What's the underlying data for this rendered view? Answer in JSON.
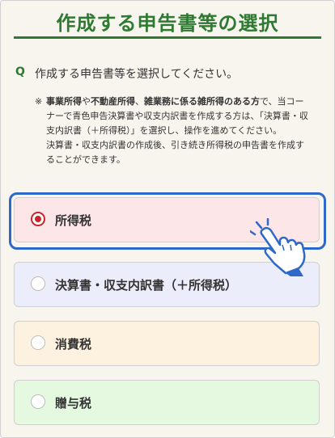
{
  "title": "作成する申告書等の選択",
  "question": {
    "label": "Q",
    "text": "作成する申告書等を選択してください。"
  },
  "note": {
    "mark": "※",
    "b1": "事業所得",
    "t1": "や",
    "b2": "不動産所得",
    "t2": "、",
    "b3": "雑業務に係る雑所得のある方",
    "t3": "で、当コーナーで青色申告決算書や収支内訳書を作成する方は、「決算書・収支内訳書（＋所得税）」を選択し、操作を進めてください。",
    "p2": "決算書・収支内訳書の作成後、引き続き所得税の申告書を作成することができます。"
  },
  "options": [
    {
      "label": "所得税",
      "color": "#fde6e8",
      "selected": true
    },
    {
      "label": "決算書・収支内訳書（＋所得税）",
      "color": "#ecedfb",
      "selected": false
    },
    {
      "label": "消費税",
      "color": "#fdf1df",
      "selected": false
    },
    {
      "label": "贈与税",
      "color": "#e4f9e0",
      "selected": false
    }
  ],
  "colors": {
    "accent_green": "#2f7a32",
    "selection_blue": "#2f68c9",
    "radio_red": "#c62828"
  },
  "icons": {
    "pointer": "hand-pointer-icon"
  }
}
